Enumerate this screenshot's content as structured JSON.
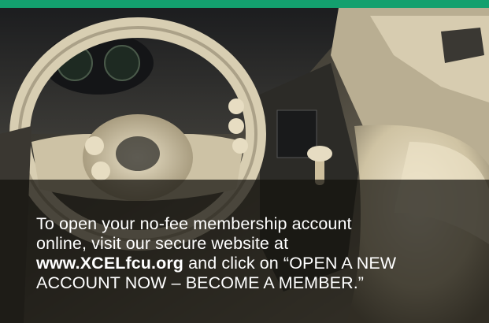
{
  "ad": {
    "line1": "To open your no-fee membership account",
    "line2": "online, visit our secure website at",
    "url": "www.XCELfcu.org",
    "line3_rest": " and click on “OPEN A NEW",
    "line4": "ACCOUNT NOW – BECOME A MEMBER.”"
  },
  "colors": {
    "accent_green": "#13a06e",
    "overlay": "#14120e",
    "caption_text": "#ffffff"
  }
}
